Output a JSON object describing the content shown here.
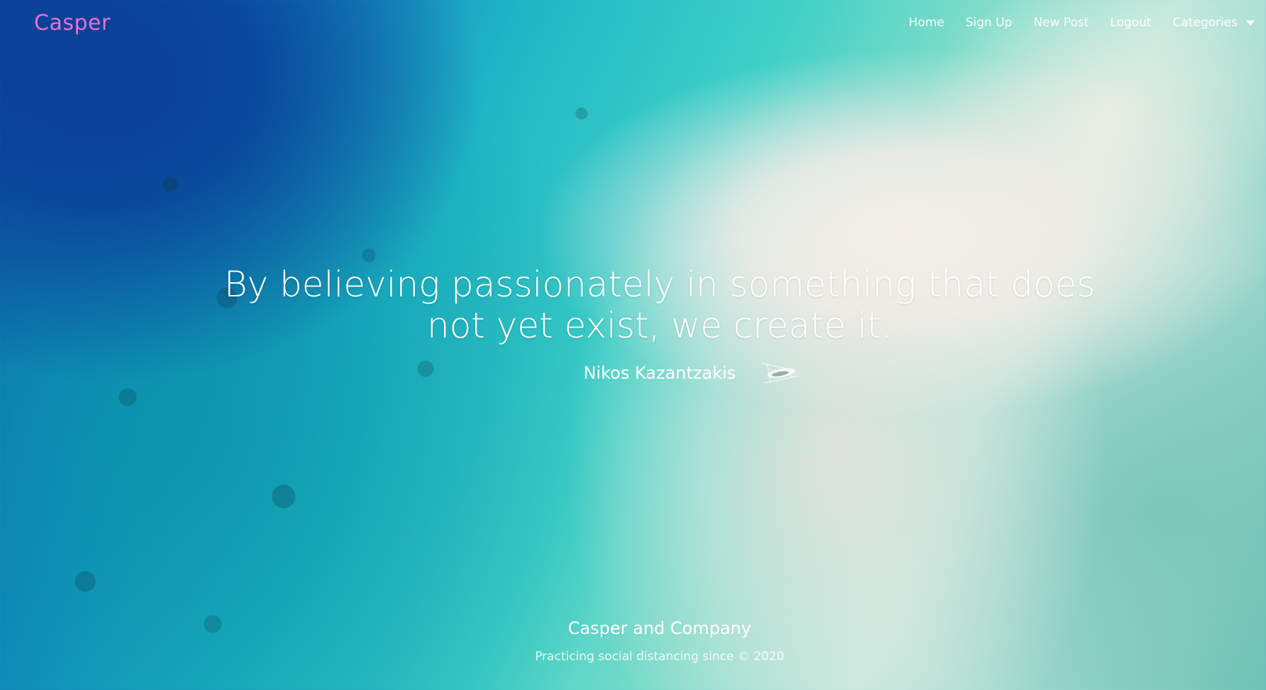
{
  "navbar": {
    "brand": "Casper",
    "links": [
      {
        "label": "Home"
      },
      {
        "label": "Sign Up"
      },
      {
        "label": "New Post"
      },
      {
        "label": "Logout"
      }
    ],
    "dropdown_label": "Categories"
  },
  "hero": {
    "quote": "By believing passionately in something that does not yet exist, we create it.",
    "author": "Nikos Kazantzakis"
  },
  "footer": {
    "title": "Casper and Company",
    "note": "Practicing social distancing since © 2020"
  },
  "colors": {
    "brand": "#e86fd2",
    "text": "#ffffff"
  },
  "icons": {
    "dropdown": "caret-down-icon",
    "boat": "boat-icon"
  }
}
